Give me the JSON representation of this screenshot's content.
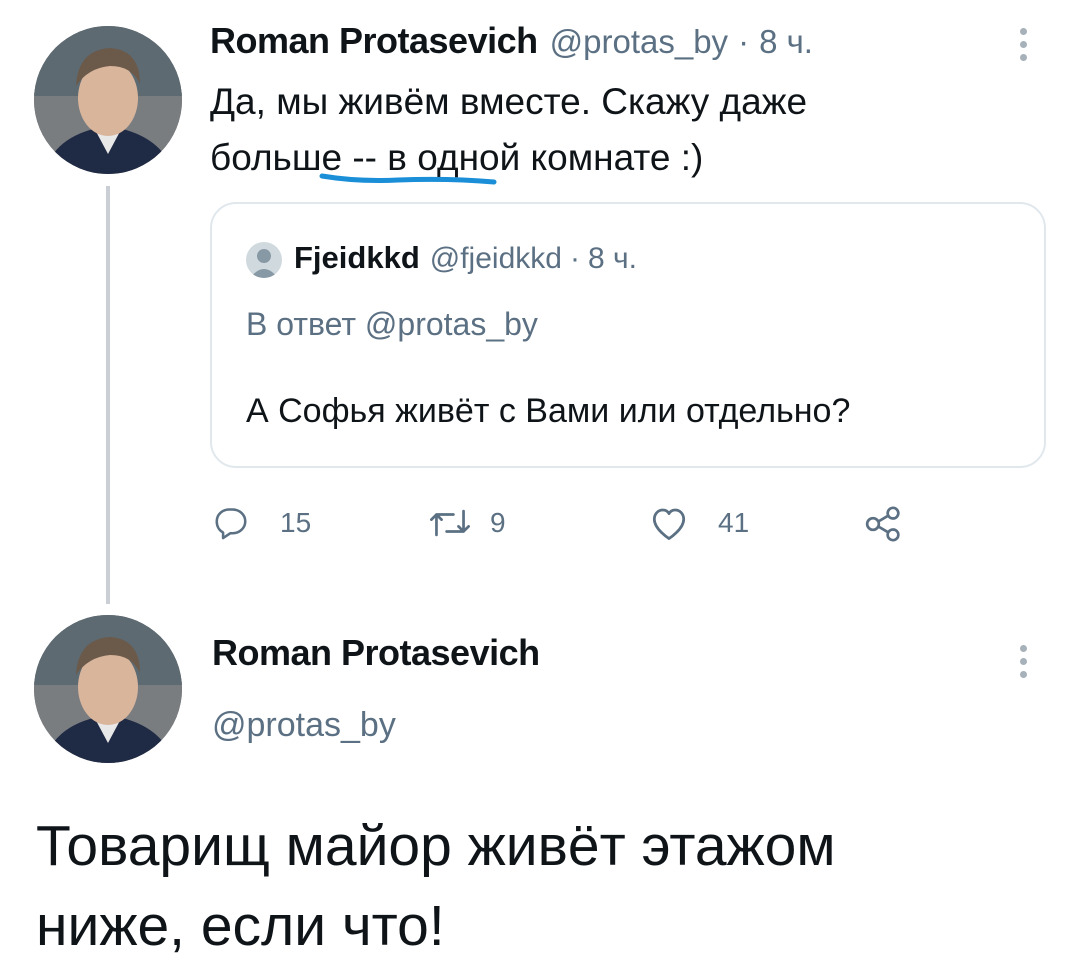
{
  "tweet1": {
    "author_name": "Roman Protasevich",
    "author_handle": "@protas_by",
    "separator": "·",
    "time": "8 ч.",
    "text_line1": "Да, мы живём вместе. Скажу даже",
    "text_line2": "больше -- в одной комнате :)",
    "quoted": {
      "author_name": "Fjeidkkd",
      "author_handle": "@fjeidkkd",
      "separator": "·",
      "time": "8 ч.",
      "reply_to": "В ответ @protas_by",
      "text": "А Софья живёт с Вами или отдельно?"
    },
    "actions": {
      "replies": "15",
      "retweets": "9",
      "likes": "41"
    }
  },
  "tweet2": {
    "author_name": "Roman Protasevich",
    "author_handle": "@protas_by",
    "text_line1": "Товарищ майор живёт этажом",
    "text_line2": "ниже, если что!"
  },
  "colors": {
    "muted": "#5b7083",
    "annotation_underline": "#1a8fd8",
    "thread_line": "#c9cfd4",
    "border": "#e1e8ed"
  }
}
